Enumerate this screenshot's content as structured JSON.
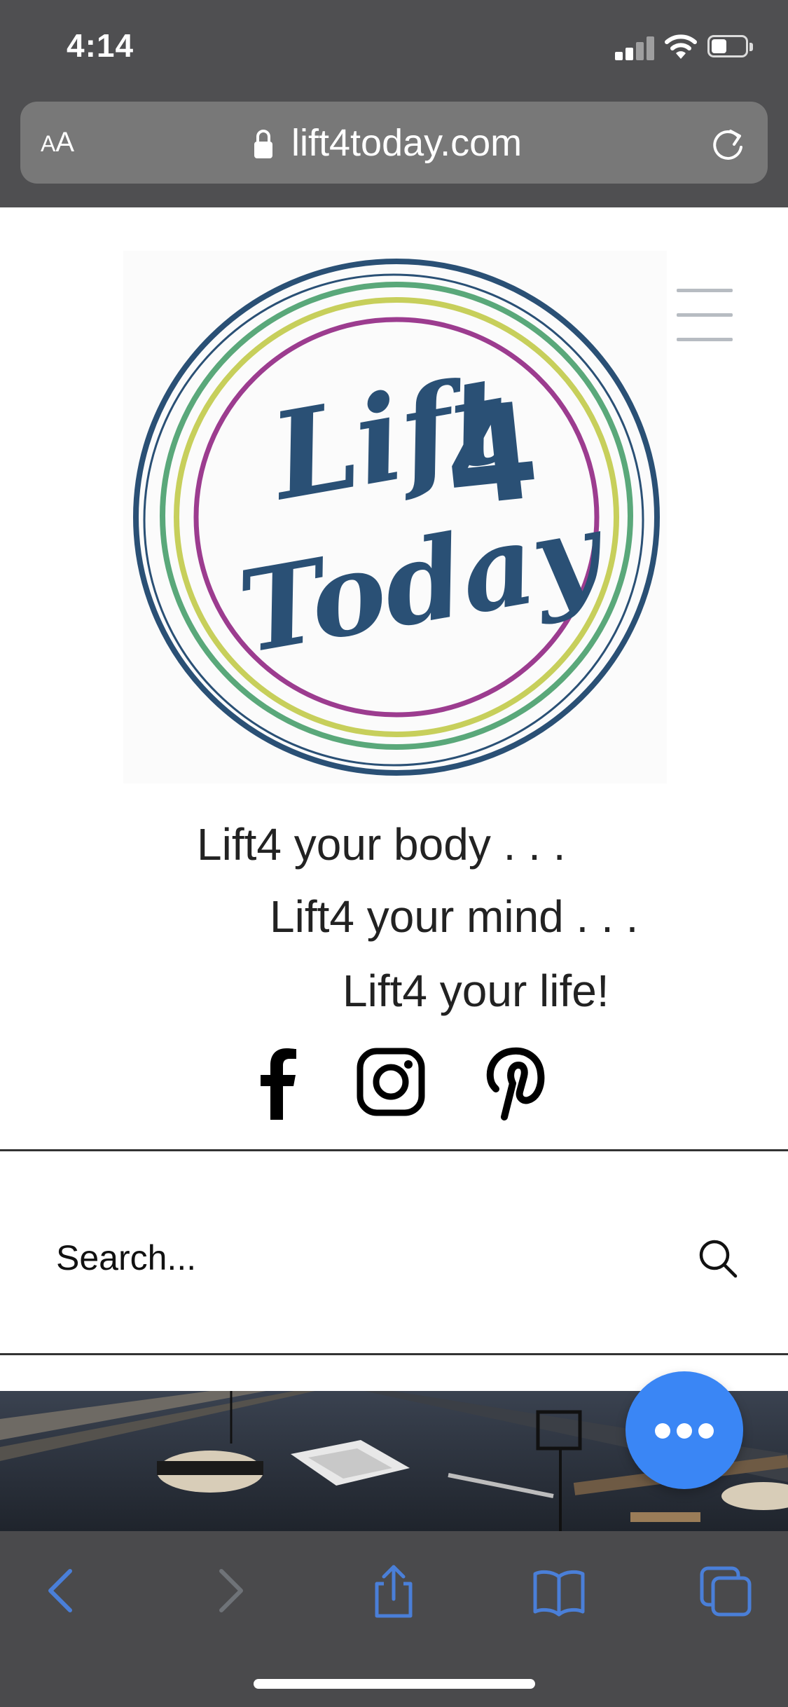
{
  "status_bar": {
    "time": "4:14",
    "battery_level": 0.45
  },
  "address_bar": {
    "aa_label_small": "A",
    "aa_label_large": "A",
    "url": "lift4today.com"
  },
  "logo": {
    "text_line1": "Lift",
    "text_digit": "4",
    "text_line2": "Today"
  },
  "taglines": [
    "Lift4 your body . . .",
    "Lift4 your mind . . .",
    "Lift4 your life!"
  ],
  "social": [
    "facebook-icon",
    "instagram-icon",
    "pinterest-icon"
  ],
  "search": {
    "placeholder": "Search..."
  },
  "colors": {
    "chrome": "#4f4f51",
    "toolbar": "#4a4a4c",
    "toolbar_icon": "#4a7fd8",
    "toolbar_icon_disabled": "#6f7378",
    "chat_button": "#3a86f5",
    "logo_navy": "#2a5075",
    "logo_green": "#5aa87a",
    "logo_lime": "#c7cf5b",
    "logo_purple": "#9c3c8f"
  }
}
